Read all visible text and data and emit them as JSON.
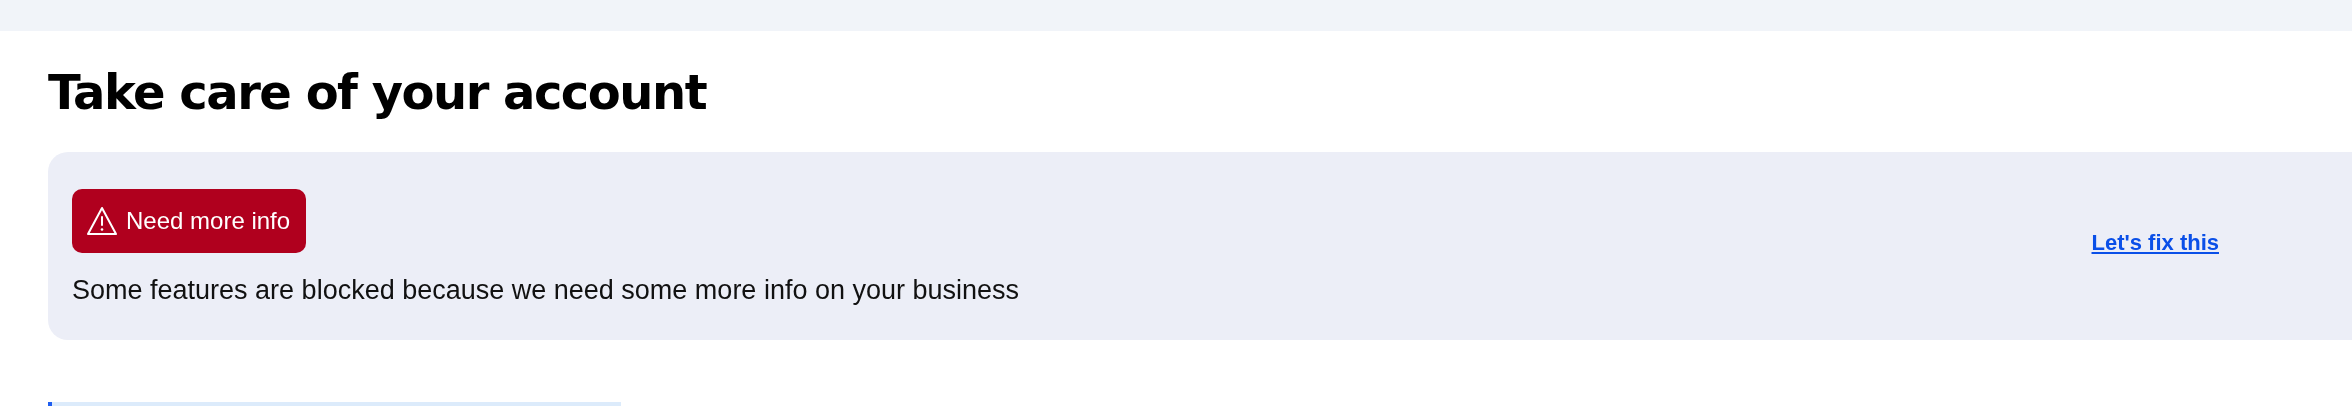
{
  "heading": "Take care of your account",
  "alert": {
    "badge": {
      "kind": "warning",
      "label": "Need more info"
    },
    "message": "Some features are blocked because we need some more info on your business",
    "link": "Let's fix this"
  }
}
